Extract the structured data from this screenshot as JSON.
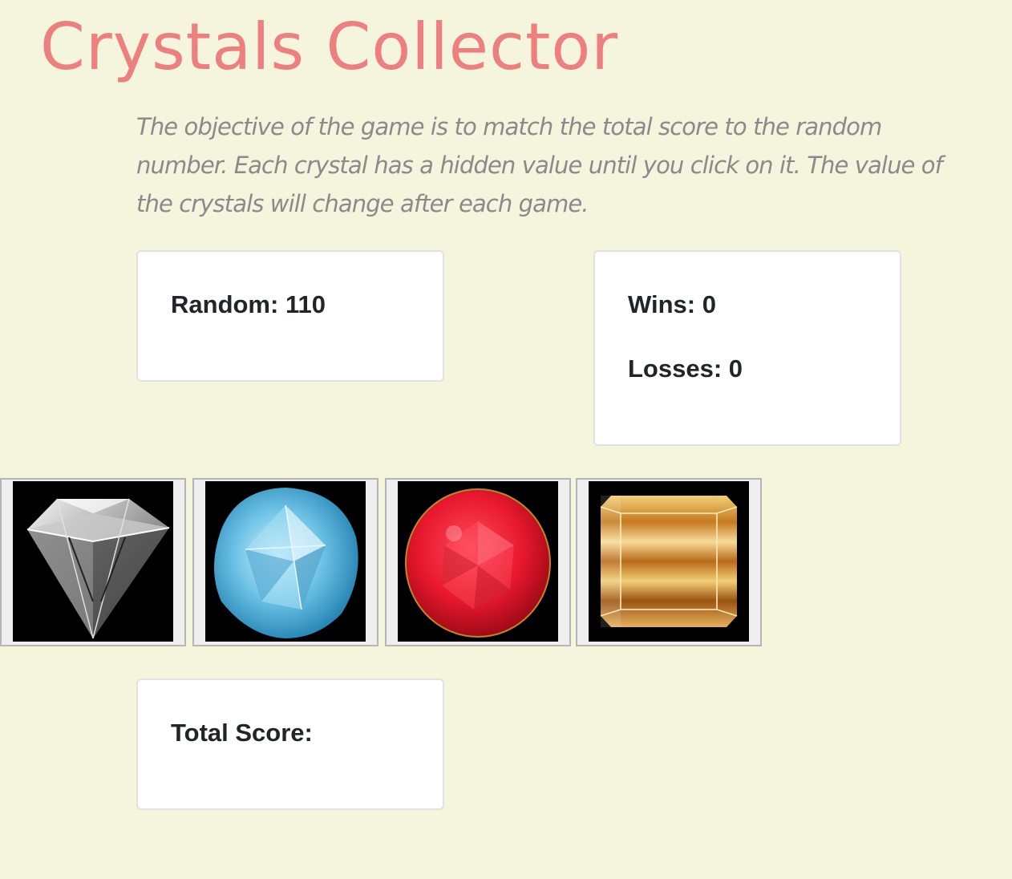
{
  "title": "Crystals Collector",
  "instructions": "The objective of the game is to match the total score to the random number. Each crystal has a hidden value until you click on it. The value of the crystals will change after each game.",
  "random": {
    "label": "Random:",
    "value": "110"
  },
  "record": {
    "wins_label": "Wins:",
    "wins": "0",
    "losses_label": "Losses:",
    "losses": "0"
  },
  "total": {
    "label": "Total Score:",
    "value": ""
  },
  "crystals": [
    {
      "name": "diamond",
      "color": "#d8d8d8"
    },
    {
      "name": "aquamarine",
      "color": "#5bb8e0"
    },
    {
      "name": "ruby",
      "color": "#e8182e"
    },
    {
      "name": "citrine",
      "color": "#e0a040"
    }
  ],
  "colors": {
    "background": "#f5f4dc",
    "title": "#ee7f7f",
    "text": "#212529"
  }
}
